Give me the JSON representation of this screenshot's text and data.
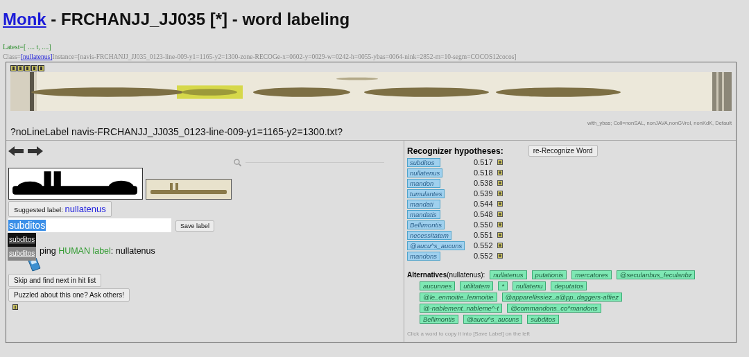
{
  "header": {
    "link": "Monk",
    "title": " - FRCHANJJ_JJ035 [*] - word labeling"
  },
  "latest": "Latest=[ .... t, ....]",
  "class_line": {
    "prefix": "Class=",
    "class_link": "[nullatenus]",
    "instance": "Instance=[navis-FRCHANJJ_JJ035_0123-line-009-y1=1165-y2=1300-zone-RECOGe-x=0602-y=0029-w=0242-h=0055-ybas=0064-nink=2852-m=10-segm=COCOS12cocos]"
  },
  "line_label": "?noLineLabel navis-FRCHANJJ_JJ035_0123-line-009-y1=1165-y2=1300.txt?",
  "settings_note": "with_ybas; Coll=nonSAL, nonJAVA,nonGVrol, nonKdK, Default",
  "suggested": {
    "prefix": "Suggested label: ",
    "word": "nullatenus"
  },
  "label_input": {
    "value": "subditos"
  },
  "save_button": "Save label",
  "dropdown": [
    {
      "text": "subditos",
      "selected": true
    },
    {
      "text": "subditos",
      "selected": false
    }
  ],
  "human_label": {
    "visible_start": "ping",
    "highlight": "HUMAN label",
    "rest": ": nullatenus"
  },
  "skip_button": "Skip and find next in hit list",
  "ask_button": "Puzzled about this one? Ask others!",
  "hypotheses_title": "Recognizer hypotheses:",
  "rerecognize_button": "re-Recognize Word",
  "hypotheses": [
    {
      "word": "subditos",
      "score": "0.517"
    },
    {
      "word": "nullatenus",
      "score": "0.518"
    },
    {
      "word": "mandon",
      "score": "0.538"
    },
    {
      "word": "tumulantes",
      "score": "0.539"
    },
    {
      "word": "mandati",
      "score": "0.544"
    },
    {
      "word": "mandatis",
      "score": "0.548"
    },
    {
      "word": "Bellimontis",
      "score": "0.550"
    },
    {
      "word": "necessitatem",
      "score": "0.551"
    },
    {
      "word": "@aucu^s_aucuns",
      "score": "0.552"
    },
    {
      "word": "mandons",
      "score": "0.552"
    }
  ],
  "alternatives": {
    "label": "Alternatives",
    "context": "(nullatenus):",
    "words": [
      {
        "text": "nullatenus",
        "new_line": false
      },
      {
        "text": "putationis",
        "new_line": false
      },
      {
        "text": "mercatores",
        "new_line": false
      },
      {
        "text": "@seculanbus_feculanbz",
        "new_line": false
      },
      {
        "text": "aucunnes",
        "new_line": true
      },
      {
        "text": "utilitatem",
        "new_line": false
      },
      {
        "text": "*",
        "new_line": false
      },
      {
        "text": "nullatenu",
        "new_line": false
      },
      {
        "text": "deputatos",
        "new_line": false
      },
      {
        "text": "@le_enmoitie_lenmoitie",
        "new_line": true
      },
      {
        "text": "@apparellissiez_a@pp_daggers-affiez",
        "new_line": false
      },
      {
        "text": "@-nablement_nableme^-t",
        "new_line": true
      },
      {
        "text": "@commandons_co^mandons",
        "new_line": false
      },
      {
        "text": "Bellimontis",
        "new_line": true
      },
      {
        "text": "@aucu^s_aucuns",
        "new_line": false
      },
      {
        "text": "subditos",
        "new_line": false
      }
    ]
  },
  "hint": "Click a word to copy it into [Save Label] on the left"
}
